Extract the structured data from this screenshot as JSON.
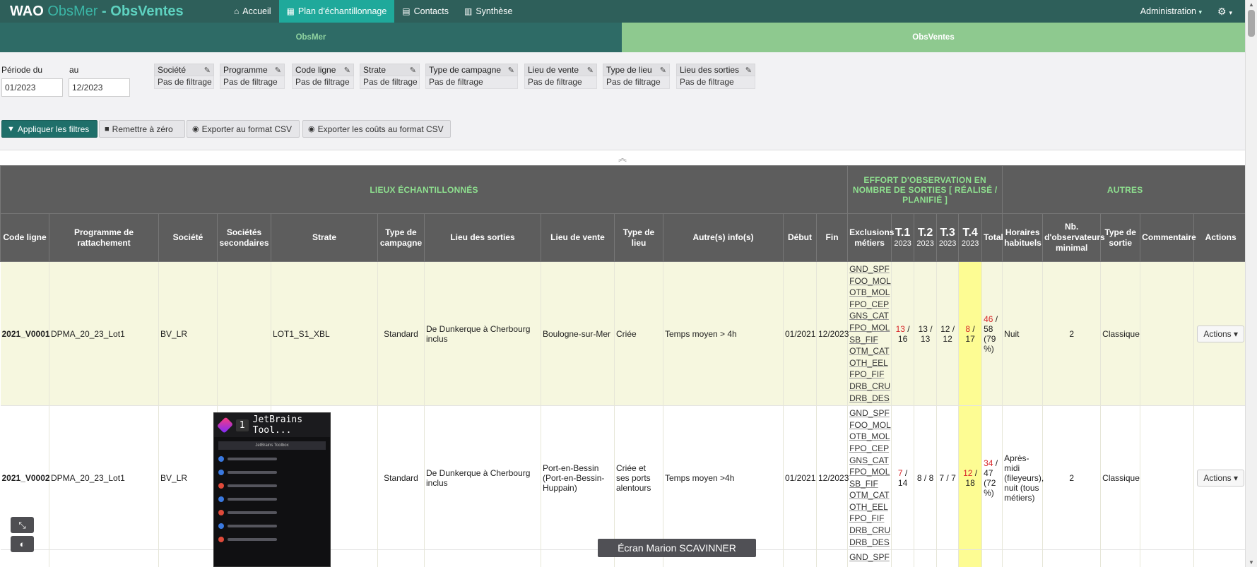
{
  "nav": {
    "brand_part1": "WAO",
    "brand_part2": "ObsMer",
    "brand_sep": "-",
    "brand_part3": "ObsVentes",
    "items": [
      {
        "label": "Accueil",
        "icon": "home-icon"
      },
      {
        "label": "Plan d'échantillonnage",
        "icon": "calendar-icon"
      },
      {
        "label": "Contacts",
        "icon": "contacts-icon"
      },
      {
        "label": "Synthèse",
        "icon": "chart-icon"
      }
    ],
    "admin_label": "Administration",
    "admin_caret": "▾",
    "gear": "⚙"
  },
  "subtabs": {
    "obsmer": "ObsMer",
    "obsventes": "ObsVentes"
  },
  "filters": {
    "period_label": "Période du",
    "to_label": "au",
    "period_from": "01/2023",
    "period_to": "12/2023",
    "boxes": [
      {
        "label": "Société",
        "value": "Pas de filtrage"
      },
      {
        "label": "Programme",
        "value": "Pas de filtrage"
      },
      {
        "label": "Code ligne",
        "value": "Pas de filtrage"
      },
      {
        "label": "Strate",
        "value": "Pas de filtrage"
      },
      {
        "label": "Type de campagne",
        "value": "Pas de filtrage"
      },
      {
        "label": "Lieu de vente",
        "value": "Pas de filtrage"
      },
      {
        "label": "Type de lieu",
        "value": "Pas de filtrage"
      },
      {
        "label": "Lieu des sorties",
        "value": "Pas de filtrage"
      }
    ],
    "apply": "Appliquer les filtres",
    "reset": "Remettre à zéro",
    "export_csv": "Exporter au format CSV",
    "export_costs": "Exporter les coûts au format CSV"
  },
  "table": {
    "group_headers": {
      "lieux": "LIEUX ÉCHANTILLONNÉS",
      "effort": "EFFORT D'OBSERVATION EN NOMBRE DE SORTIES [ RÉALISÉ / PLANIFIÉ ]",
      "autres": "AUTRES"
    },
    "columns": {
      "code": "Code ligne",
      "programme": "Programme de rattachement",
      "societe": "Société",
      "societes_sec": "Sociétés secondaires",
      "strate": "Strate",
      "type_campagne": "Type de campagne",
      "lieu_sorties": "Lieu des sorties",
      "lieu_vente": "Lieu de vente",
      "type_lieu": "Type de lieu",
      "autres_infos": "Autre(s) info(s)",
      "debut": "Début",
      "fin": "Fin",
      "exclusions": "Exclusions métiers",
      "t1": "T.1",
      "t2": "T.2",
      "t3": "T.3",
      "t4": "T.4",
      "year": "2023",
      "total": "Total",
      "horaires": "Horaires habituels",
      "nb_obs": "Nb. d'observateurs minimal",
      "type_sortie": "Type de sortie",
      "commentaire": "Commentaire",
      "actions": "Actions"
    },
    "exclusions": [
      "GND_SPF",
      "FOO_MOL",
      "OTB_MOL",
      "FPO_CEP",
      "GNS_CAT",
      "FPO_MOL",
      "SB_FIF",
      "OTM_CAT",
      "OTH_EEL",
      "FPO_FIF",
      "DRB_CRU",
      "DRB_DES"
    ],
    "rows": [
      {
        "code": "2021_V0001",
        "programme": "DPMA_20_23_Lot1",
        "societe": "BV_LR",
        "societes_sec": "",
        "strate": "LOT1_S1_XBL",
        "type_campagne": "Standard",
        "lieu_sorties": "De Dunkerque à Cherbourg inclus",
        "lieu_vente": "Boulogne-sur-Mer",
        "type_lieu": "Criée",
        "autres_infos": "Temps moyen > 4h",
        "debut": "01/2021",
        "fin": "12/2023",
        "t1_done": "13",
        "t1_plan": " / 16",
        "t2": "13 / 13",
        "t3": "12 / 12",
        "t4_done": "8",
        "t4_plan": " / 17",
        "total_done": "46",
        "total_plan": " / 58 (79 %)",
        "horaires": "Nuit",
        "nb_obs": "2",
        "type_sortie": "Classique",
        "commentaire": "",
        "action": "Actions ▾"
      },
      {
        "code": "2021_V0002",
        "programme": "DPMA_20_23_Lot1",
        "societe": "BV_LR",
        "societes_sec": "",
        "strate": "",
        "type_campagne": "Standard",
        "lieu_sorties": "De Dunkerque à Cherbourg inclus",
        "lieu_vente": "Port-en-Bessin (Port-en-Bessin-Huppain)",
        "type_lieu": "Criée et ses ports alentours",
        "autres_infos": "Temps moyen >4h",
        "debut": "01/2021",
        "fin": "12/2023",
        "t1_done": "7",
        "t1_plan": " / 14",
        "t2": "8 / 8",
        "t3": "7 / 7",
        "t4_done": "12",
        "t4_plan": " / 18",
        "total_done": "34",
        "total_plan": " / 47 (72 %)",
        "horaires": "Après-midi (fileyeurs), nuit (tous métiers)",
        "nb_obs": "2",
        "type_sortie": "Classique",
        "commentaire": "",
        "action": "Actions ▾"
      }
    ],
    "row3_exclusions": [
      "GND_SPF"
    ]
  },
  "overlay": {
    "jb_num": "1",
    "jb_title": "JetBrains Tool...",
    "jb_bar": "JetBrains Toolbox",
    "screen_label": "Écran Marion SCAVINNER"
  },
  "colors": {
    "nav_bg": "#2e5f5a",
    "active_tab": "#1fa99b",
    "obsventes_tab": "#8ec98f",
    "header_bg": "#5d5d5d",
    "t4_highlight": "#fdfc93",
    "red": "#d8282b"
  }
}
